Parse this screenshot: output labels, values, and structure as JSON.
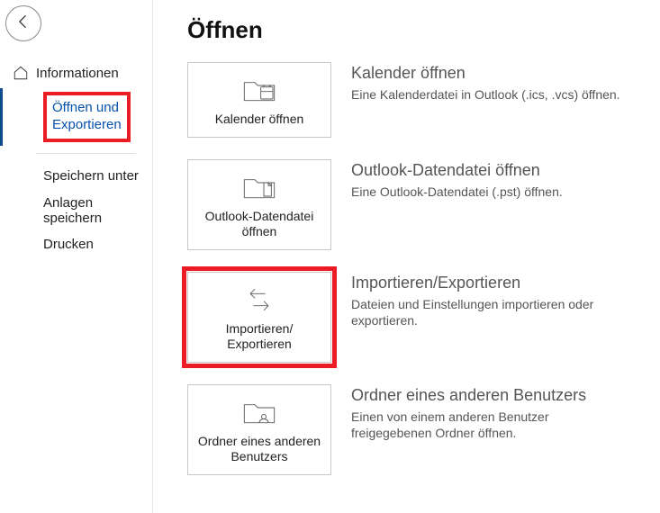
{
  "sidebar": {
    "items": [
      {
        "label": "Informationen"
      },
      {
        "label": "Öffnen und\nExportieren"
      },
      {
        "label": "Speichern unter"
      },
      {
        "label": "Anlagen\nspeichern"
      },
      {
        "label": "Drucken"
      }
    ]
  },
  "page": {
    "title": "Öffnen"
  },
  "options": [
    {
      "tile_label": "Kalender öffnen",
      "title": "Kalender öffnen",
      "desc": "Eine Kalenderdatei in Outlook (.ics, .vcs) öffnen."
    },
    {
      "tile_label": "Outlook-Datendatei öffnen",
      "title": "Outlook-Datendatei öffnen",
      "desc": "Eine Outlook-Datendatei (.pst) öffnen."
    },
    {
      "tile_label": "Importieren/\nExportieren",
      "title": "Importieren/Exportieren",
      "desc": "Dateien und Einstellungen importieren oder exportieren."
    },
    {
      "tile_label": "Ordner eines anderen Benutzers",
      "title": "Ordner eines anderen Benutzers",
      "desc": "Einen von einem anderen Benutzer freigegebenen Ordner öffnen."
    }
  ]
}
